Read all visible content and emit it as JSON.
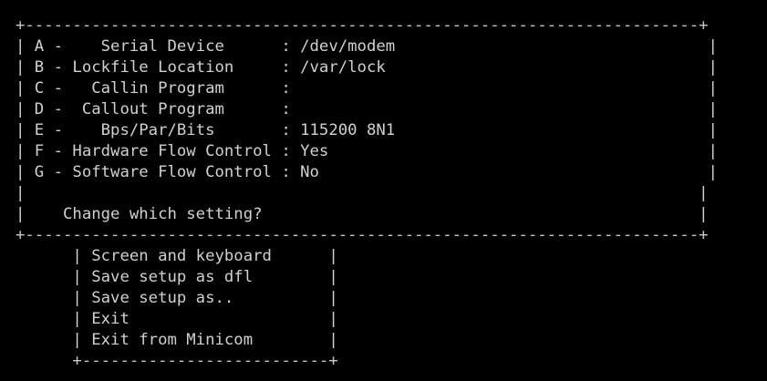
{
  "theme": {
    "background": "#000000",
    "foreground": "#d0d0d0"
  },
  "config_dialog": {
    "top_border": "+-----------------------------------------------------------------------+",
    "bottom_border": "+-----------------------------------------------------------------------+",
    "settings": [
      {
        "line": "| A -    Serial Device      : /dev/modem                                 |"
      },
      {
        "line": "| B - Lockfile Location     : /var/lock                                  |"
      },
      {
        "line": "| C -   Callin Program      :                                            |"
      },
      {
        "line": "| D -  Callout Program      :                                            |"
      },
      {
        "line": "| E -    Bps/Par/Bits       : 115200 8N1                                 |"
      },
      {
        "line": "| F - Hardware Flow Control : Yes                                        |"
      },
      {
        "line": "| G - Software Flow Control : No                                         |"
      }
    ],
    "blank_line": "|                                                                       |",
    "prompt_line": "|    Change which setting?                                              |"
  },
  "menu": {
    "items": [
      {
        "line": "      | Screen and keyboard      |"
      },
      {
        "line": "      | Save setup as dfl        |"
      },
      {
        "line": "      | Save setup as..          |"
      },
      {
        "line": "      | Exit                     |"
      },
      {
        "line": "      | Exit from Minicom        |"
      }
    ],
    "bottom_border": "      +--------------------------+"
  }
}
